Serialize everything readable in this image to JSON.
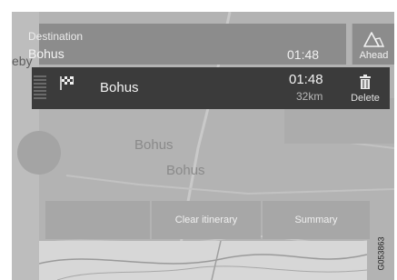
{
  "map": {
    "place_label": "eby",
    "ghost_text_1": "Bohus",
    "ghost_text_2": "Bohus"
  },
  "header": {
    "label": "Destination",
    "destination": "Bohus",
    "time": "01:48"
  },
  "ahead": {
    "label": "Ahead",
    "icon": "ahead-warning-icon"
  },
  "itinerary_row": {
    "icon": "checkered-flag-icon",
    "name": "Bohus",
    "time": "01:48",
    "distance": "32km"
  },
  "delete": {
    "label": "Delete",
    "icon": "trash-icon"
  },
  "actions": {
    "left_label": "",
    "clear_label": "Clear itinerary",
    "summary_label": "Summary"
  },
  "figure_code": "G053863",
  "colors": {
    "row_bg": "#3b3b3b",
    "header_bg": "#8c8c8c",
    "map_bg": "#b9b9b9"
  }
}
